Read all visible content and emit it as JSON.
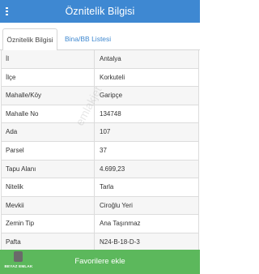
{
  "header": {
    "title": "Öznitelik Bilgisi",
    "menu_icon": "menu-icon"
  },
  "tabs": [
    {
      "label": "Öznitelik Bilgisi",
      "active": true
    },
    {
      "label": "Bina/BB Listesi",
      "active": false
    }
  ],
  "rows": [
    {
      "label": "İl",
      "value": "Antalya"
    },
    {
      "label": "İlçe",
      "value": "Korkuteli"
    },
    {
      "label": "Mahalle/Köy",
      "value": "Garipçe"
    },
    {
      "label": "Mahalle No",
      "value": "134748"
    },
    {
      "label": "Ada",
      "value": "107"
    },
    {
      "label": "Parsel",
      "value": "37"
    },
    {
      "label": "Tapu Alanı",
      "value": "4.699,23"
    },
    {
      "label": "Nitelik",
      "value": "Tarla"
    },
    {
      "label": "Mevkii",
      "value": "Ciroğlu Yeri"
    },
    {
      "label": "Zemin Tip",
      "value": "Ana Taşınmaz"
    },
    {
      "label": "Pafta",
      "value": "N24-B-18-D-3"
    }
  ],
  "watermark": "emlakjet",
  "footer": {
    "button_label": "Favorilere ekle"
  },
  "logo": {
    "text": "BEYAZ EMLAK"
  },
  "colors": {
    "header": "#3e88d2",
    "tab_link": "#3f88d0",
    "footer": "#5cb85c"
  }
}
